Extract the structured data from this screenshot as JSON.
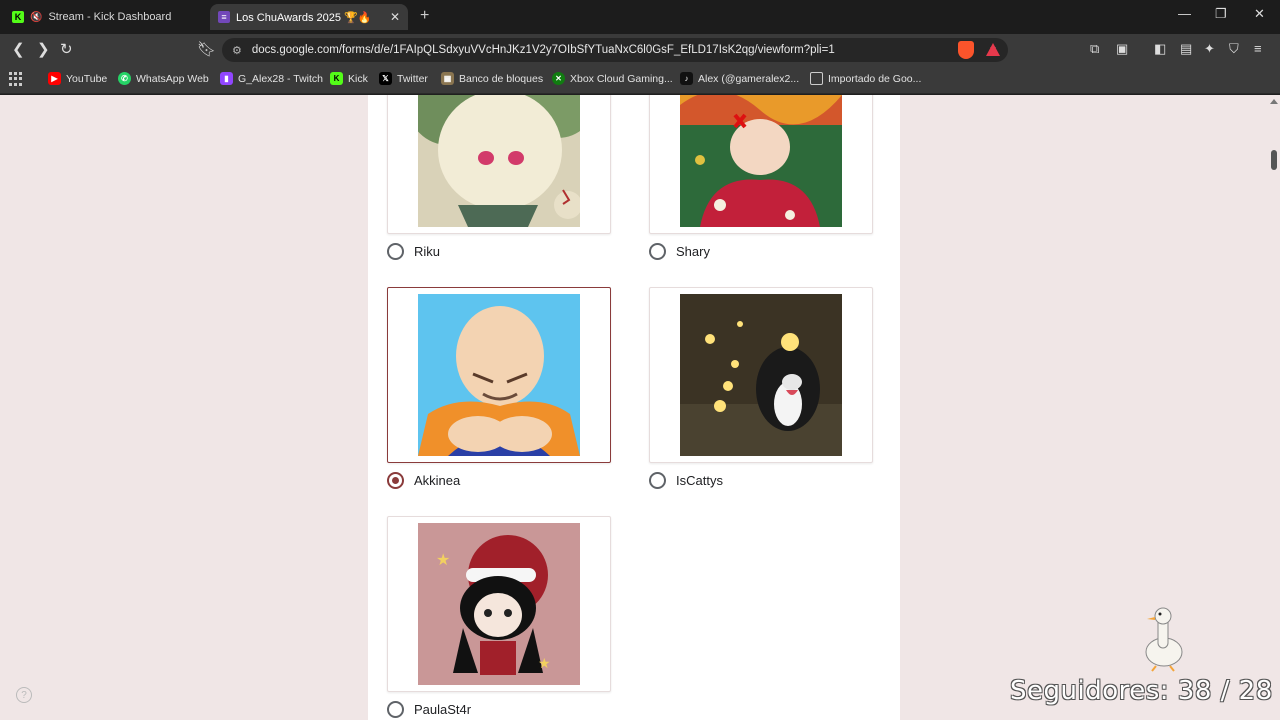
{
  "tabs": [
    {
      "title": "Stream - Kick Dashboard",
      "active": false
    },
    {
      "title": "Los ChuAwards 2025 🏆🔥",
      "active": true
    }
  ],
  "address_bar": {
    "url": "docs.google.com/forms/d/e/1FAIpQLSdxyuVVcHnJKz1V2y7OIbSfYTuaNxC6l0GsF_EfLD17IsK2qg/viewform?pli=1"
  },
  "bookmarks": [
    {
      "label": "YouTube",
      "icon": "youtube-icon",
      "color": "#ff0000"
    },
    {
      "label": "WhatsApp Web",
      "icon": "whatsapp-icon",
      "color": "#25d366"
    },
    {
      "label": "G_Alex28 - Twitch",
      "icon": "twitch-icon",
      "color": "#9146ff"
    },
    {
      "label": "Kick",
      "icon": "kick-icon",
      "color": "#53fc18"
    },
    {
      "label": "Twitter",
      "icon": "x-icon",
      "color": "#000000"
    },
    {
      "label": "Banco de bloques",
      "icon": "block-icon",
      "color": "#c0a060"
    },
    {
      "label": "Xbox Cloud Gaming...",
      "icon": "xbox-icon",
      "color": "#107c10"
    },
    {
      "label": "Alex (@gameralex2...",
      "icon": "tiktok-icon",
      "color": "#111111"
    },
    {
      "label": "Importado de Goo...",
      "icon": "folder-icon",
      "color": "#cccccc"
    }
  ],
  "form": {
    "options": [
      {
        "label": "Riku",
        "selected": false
      },
      {
        "label": "Shary",
        "selected": false
      },
      {
        "label": "Akkinea",
        "selected": true
      },
      {
        "label": "IsCattys",
        "selected": false
      },
      {
        "label": "PaulaSt4r",
        "selected": false
      }
    ]
  },
  "overlay": {
    "followers": "Seguidores: 38 / 28"
  },
  "colors": {
    "accent": "#8a3b3b",
    "page_bg": "#f0e6e6",
    "chrome_bg": "#3a3a3a"
  }
}
